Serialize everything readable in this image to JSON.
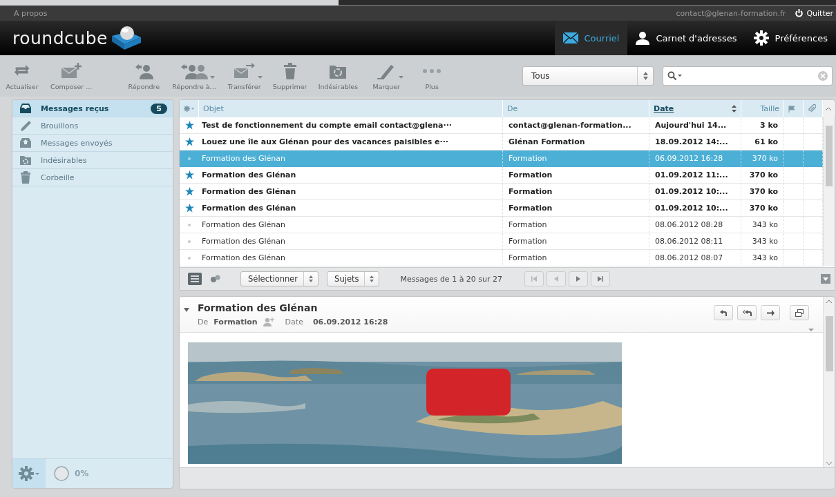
{
  "top_bar": {
    "about": "A propos",
    "user": "contact@glenan-formation.fr",
    "logout": "Quitter"
  },
  "header": {
    "logo": "roundcube",
    "nav": [
      {
        "label": "Courriel",
        "kind": "mail",
        "selected": true
      },
      {
        "label": "Carnet d'adresses",
        "kind": "contacts",
        "selected": false
      },
      {
        "label": "Préférences",
        "kind": "settings",
        "selected": false
      }
    ]
  },
  "toolbar": {
    "groups": [
      [
        {
          "label": "Actualiser",
          "kind": "refresh",
          "dropdown": false
        },
        {
          "label": "Composer ...",
          "kind": "compose",
          "dropdown": false
        }
      ],
      [
        {
          "label": "Répondre",
          "kind": "reply",
          "dropdown": false
        },
        {
          "label": "Répondre à...",
          "kind": "replyall",
          "dropdown": true
        },
        {
          "label": "Transférer",
          "kind": "forward",
          "dropdown": true
        },
        {
          "label": "Supprimer",
          "kind": "delete",
          "dropdown": false
        },
        {
          "label": "Indésirables",
          "kind": "junk",
          "dropdown": false
        },
        {
          "label": "Marquer",
          "kind": "mark",
          "dropdown": true
        },
        {
          "label": "Plus",
          "kind": "more",
          "dropdown": false
        }
      ]
    ],
    "filter": "Tous"
  },
  "folders": [
    {
      "name": "Messages reçus",
      "kind": "inbox",
      "selected": true,
      "count": "5"
    },
    {
      "name": "Brouillons",
      "kind": "drafts",
      "selected": false
    },
    {
      "name": "Messages envoyés",
      "kind": "sent",
      "selected": false
    },
    {
      "name": "Indésirables",
      "kind": "junk",
      "selected": false
    },
    {
      "name": "Corbeille",
      "kind": "trash",
      "selected": false
    }
  ],
  "quota": {
    "text": "0%"
  },
  "messages": {
    "columns": [
      {
        "label": "Objet",
        "sorted": false
      },
      {
        "label": "De",
        "sorted": false
      },
      {
        "label": "Date",
        "sorted": true
      },
      {
        "label": "Taille",
        "sorted": false
      }
    ],
    "rows": [
      {
        "subject": "Test de fonctionnement du compte email contact@glena···",
        "from": "contact@glenan-formation...",
        "date": "Aujourd'hui 14...",
        "size": "3 ko",
        "unread": true,
        "selected": false
      },
      {
        "subject": "Louez une île aux Glénan pour des vacances paisibles e···",
        "from": "Glénan Formation",
        "date": "18.09.2012 14:...",
        "size": "61 ko",
        "unread": true,
        "selected": false
      },
      {
        "subject": "Formation des Glénan",
        "from": "Formation",
        "date": "06.09.2012 16:28",
        "size": "370 ko",
        "unread": false,
        "selected": true
      },
      {
        "subject": "Formation des Glénan",
        "from": "Formation",
        "date": "01.09.2012 11:...",
        "size": "370 ko",
        "unread": true,
        "selected": false
      },
      {
        "subject": "Formation des Glénan",
        "from": "Formation",
        "date": "01.09.2012 10:...",
        "size": "370 ko",
        "unread": true,
        "selected": false
      },
      {
        "subject": "Formation des Glénan",
        "from": "Formation",
        "date": "01.09.2012 10:...",
        "size": "370 ko",
        "unread": true,
        "selected": false
      },
      {
        "subject": "Formation des Glénan",
        "from": "Formation",
        "date": "08.06.2012 08:28",
        "size": "343 ko",
        "unread": false,
        "selected": false
      },
      {
        "subject": "Formation des Glénan",
        "from": "Formation",
        "date": "08.06.2012 08:11",
        "size": "343 ko",
        "unread": false,
        "selected": false
      },
      {
        "subject": "Formation des Glénan",
        "from": "Formation",
        "date": "08.06.2012 08:07",
        "size": "343 ko",
        "unread": false,
        "selected": false
      }
    ],
    "footer": {
      "select": "Sélectionner",
      "threads": "Sujets",
      "count": "Messages de 1 à 20 sur 27"
    }
  },
  "preview": {
    "subject": "Formation des Glénan",
    "from_label": "De",
    "from": "Formation",
    "date_label": "Date",
    "date": "06.09.2012 16:28"
  }
}
